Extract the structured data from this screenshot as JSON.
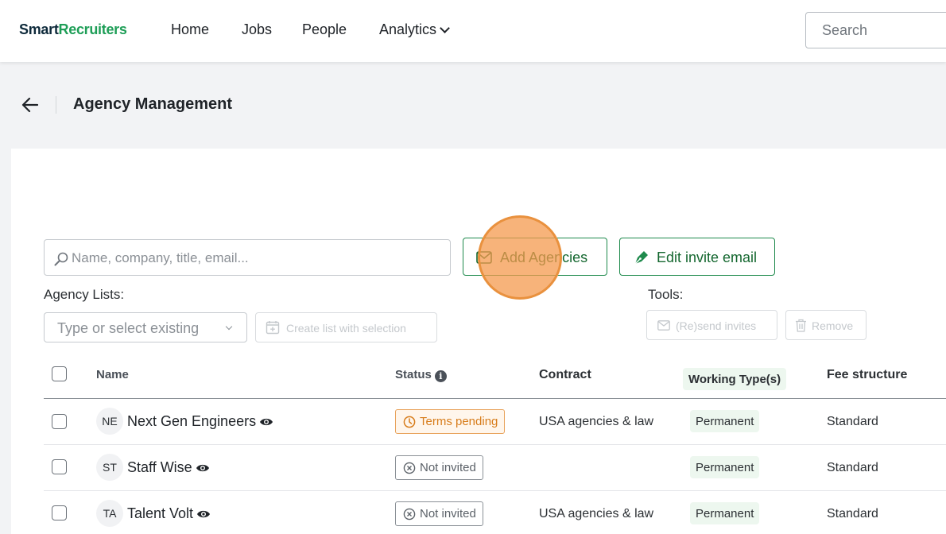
{
  "nav": {
    "logo_part1": "Smart",
    "logo_part2": "Recruiters",
    "items": [
      "Home",
      "Jobs",
      "People",
      "Analytics"
    ],
    "search_placeholder": "Search"
  },
  "page": {
    "title": "Agency Management"
  },
  "toolbar": {
    "filter_placeholder": "Name, company, title, email...",
    "add_agencies_label": "Add Agencies",
    "edit_invite_label": "Edit invite email",
    "agency_lists_label": "Agency Lists:",
    "lists_select_placeholder": "Type or select existing",
    "create_list_label": "Create list with selection",
    "tools_label": "Tools:",
    "resend_label": "(Re)send invites",
    "remove_label": "Remove"
  },
  "table": {
    "headers": {
      "name": "Name",
      "status": "Status",
      "contract": "Contract",
      "working_type": "Working Type(s)",
      "fee_structure": "Fee structure"
    },
    "rows": [
      {
        "initials": "NE",
        "name": "Next Gen Engineers",
        "status": "Terms pending",
        "status_kind": "pending",
        "contract": "USA agencies & law",
        "working_type": "Permanent",
        "fee": "Standard"
      },
      {
        "initials": "ST",
        "name": "Staff Wise",
        "status": "Not invited",
        "status_kind": "not-invited",
        "contract": "",
        "working_type": "Permanent",
        "fee": "Standard"
      },
      {
        "initials": "TA",
        "name": "Talent Volt",
        "status": "Not invited",
        "status_kind": "not-invited",
        "contract": "USA agencies & law",
        "working_type": "Permanent",
        "fee": "Standard"
      }
    ]
  },
  "colors": {
    "brand_green": "#1e9e57",
    "brand_dark": "#0e2a3b",
    "pending_orange": "#d77c1a",
    "click_highlight": "#f49a4d"
  }
}
